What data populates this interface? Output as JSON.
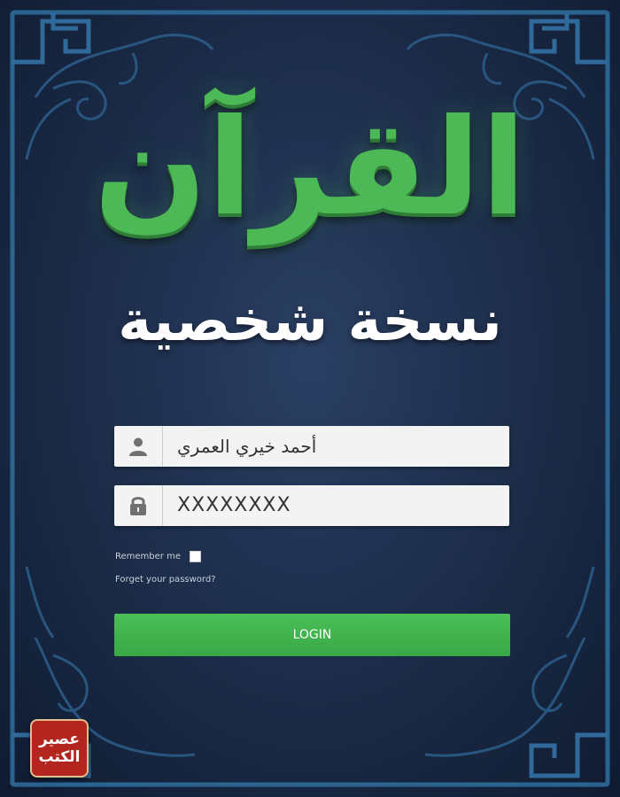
{
  "app": {
    "title": "القرآن",
    "subtitle": "نسخة شخصية"
  },
  "form": {
    "username_value": "أحمد خيري العمري",
    "password_value": "XXXXXXXX",
    "remember_label": "Remember me",
    "forgot_label": "Forget your password?",
    "login_label": "LOGIN"
  },
  "watermark": {
    "line1": "عصير",
    "line2": "الكتب"
  },
  "colors": {
    "background": "#1b2b47",
    "title_green": "#4cb856",
    "button_green": "#3fb34d",
    "ornament_blue": "#2f6a9a"
  },
  "icons": {
    "username": "user-icon",
    "password": "lock-icon"
  }
}
